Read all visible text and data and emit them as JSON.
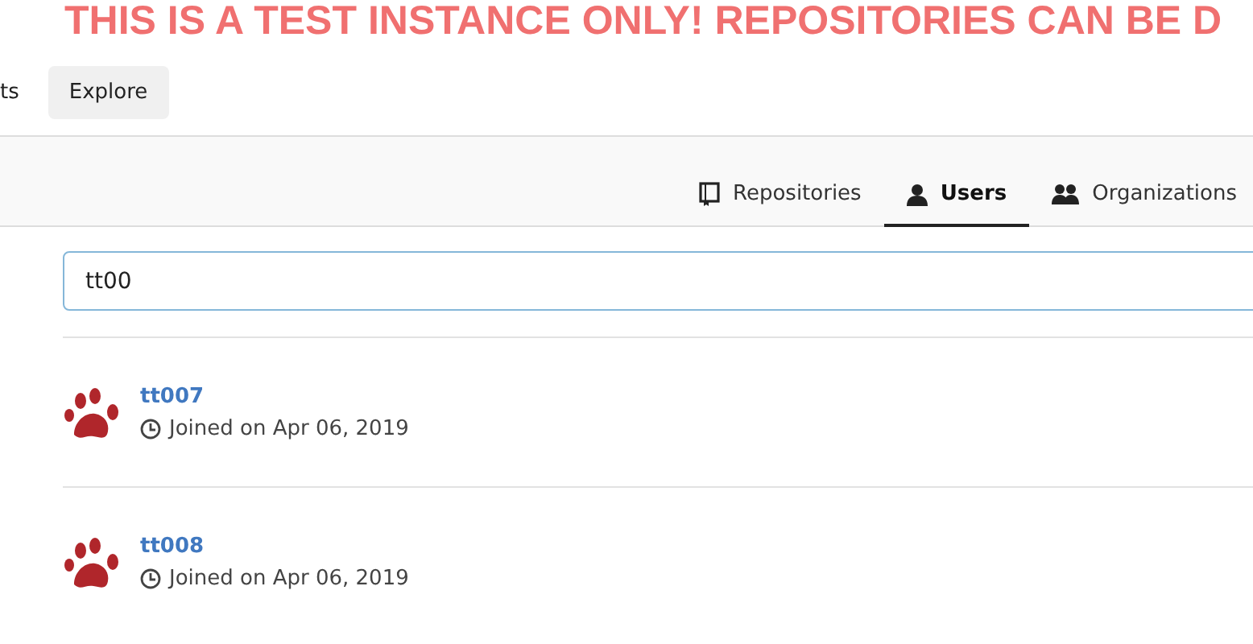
{
  "banner": {
    "text": "THIS IS A TEST INSTANCE ONLY! REPOSITORIES CAN BE D"
  },
  "nav": [
    {
      "label": "ts",
      "selected": false
    },
    {
      "label": "Explore",
      "selected": true
    }
  ],
  "tabs": [
    {
      "label": "Repositories",
      "kind": "book",
      "selected": false
    },
    {
      "label": "Users",
      "kind": "user",
      "selected": true
    },
    {
      "label": "Organizations",
      "kind": "group",
      "selected": false
    }
  ],
  "search": {
    "value": "tt00"
  },
  "users": [
    {
      "name": "tt007",
      "joined": "Joined on Apr 06, 2019"
    },
    {
      "name": "tt008",
      "joined": "Joined on Apr 06, 2019"
    }
  ]
}
